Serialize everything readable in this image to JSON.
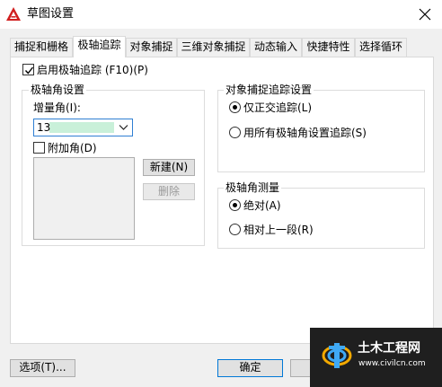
{
  "window": {
    "title": "草图设置",
    "icon": "autocad-a-icon",
    "close": "close-icon"
  },
  "tabs": [
    {
      "label": "捕捉和栅格",
      "active": false
    },
    {
      "label": "极轴追踪",
      "active": true
    },
    {
      "label": "对象捕捉",
      "active": false
    },
    {
      "label": "三维对象捕捉",
      "active": false
    },
    {
      "label": "动态输入",
      "active": false
    },
    {
      "label": "快捷特性",
      "active": false
    },
    {
      "label": "选择循环",
      "active": false
    }
  ],
  "polar": {
    "enable_label": "启用极轴追踪 (F10)(P)",
    "enable_checked": true,
    "angle_group": {
      "title": "极轴角设置",
      "increment_label": "增量角(I):",
      "increment_value": "13",
      "additional_label": "附加角(D)",
      "additional_checked": false,
      "new_button": "新建(N)",
      "delete_button": "删除"
    },
    "osnap_group": {
      "title": "对象捕捉追踪设置",
      "orthogonal_label": "仅正交追踪(L)",
      "all_label": "用所有极轴角设置追踪(S)",
      "selected": "orthogonal"
    },
    "measure_group": {
      "title": "极轴角测量",
      "absolute_label": "绝对(A)",
      "relative_label": "相对上一段(R)",
      "selected": "absolute"
    }
  },
  "footer": {
    "options_button": "选项(T)...",
    "ok_button": "确定"
  },
  "watermark": {
    "name": "土木工程网",
    "url": "www.civilcn.com"
  },
  "colors": {
    "accent": "#0078d7",
    "combo_highlight": "#c9f0d9",
    "app_icon": "#d11f1f"
  }
}
